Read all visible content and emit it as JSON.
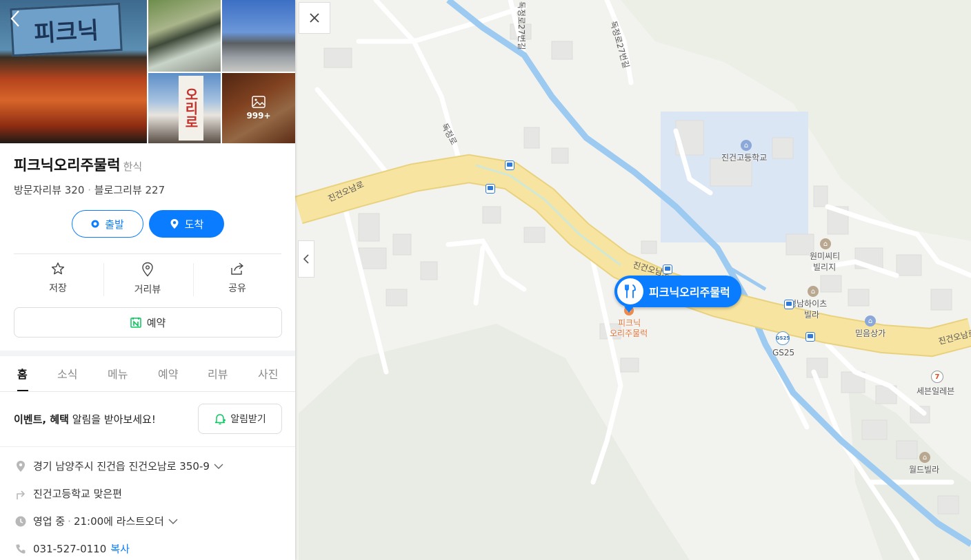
{
  "colors": {
    "accent": "#0a7cff",
    "road_main": "#f7e4a0",
    "stream": "#9ccaf0",
    "school_zone": "#dbe6f5",
    "naver_green": "#03c75a"
  },
  "panel": {
    "back_icon": "chevron-left-icon",
    "photo_count": "999+",
    "photo_sign_text": "피크닉",
    "photo_banner_text": "오리로",
    "title": "피크닉오리주물럭",
    "category": "한식",
    "visitor_reviews": "방문자리뷰 320",
    "separator": "·",
    "blog_reviews": "블로그리뷰 227",
    "departure_label": "출발",
    "arrival_label": "도착",
    "actions": [
      {
        "label": "저장",
        "icon": "star-icon"
      },
      {
        "label": "거리뷰",
        "icon": "map-pin-outline-icon"
      },
      {
        "label": "공유",
        "icon": "share-icon"
      }
    ],
    "reservation_label": "예약",
    "tabs": [
      "홈",
      "소식",
      "메뉴",
      "예약",
      "리뷰",
      "사진"
    ],
    "active_tab": "홈",
    "notice_bold": "이벤트, 혜택",
    "notice_rest": " 알림을 받아보세요!",
    "notice_button": "알림받기",
    "address": "경기 남양주시 진건읍 진건오남로 350-9",
    "directions": "진건고등학교 맞은편",
    "hours_status": "영업 중",
    "hours_detail": "21:00에 라스트오더",
    "phone": "031-527-0110",
    "copy_label": "복사"
  },
  "map": {
    "close_icon": "close-icon",
    "collapse_icon": "chevron-left-icon",
    "marker_label": "피크닉오리주물럭",
    "marker_sub_line1": "피크닉",
    "marker_sub_line2": "오리주물럭",
    "labels": {
      "road_left": "진건오남로",
      "road_mid": "진건오남로",
      "road_right": "진건오남로",
      "road_north": "독정로",
      "road_north2": "독정로27번길",
      "road_top": "독정로27번길",
      "school": "진건고등학교",
      "villa1_line1": "원미씨티",
      "villa1_line2": "빌리지",
      "villa2_line1": "경남하이츠",
      "villa2_line2": "빌라",
      "shop": "믿음상가",
      "gs25": "GS25",
      "gs25_logo": "GS25",
      "seven": "세븐일레븐",
      "world": "월드빌라"
    }
  }
}
